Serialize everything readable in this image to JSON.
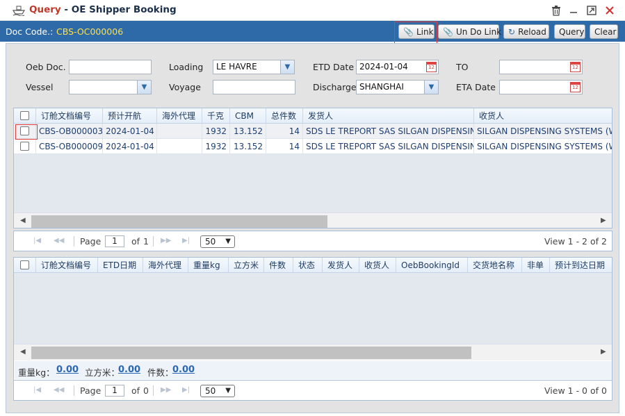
{
  "window": {
    "title_prefix": "Query",
    "title_separator": " - ",
    "title_main": "OE Shipper Booking",
    "icons": [
      "ship-icon",
      "trash-icon",
      "minimize-icon",
      "maximize-icon",
      "close-icon"
    ]
  },
  "docbar": {
    "label": "Doc Code.:",
    "value": "CBS-OC000006",
    "buttons": {
      "link": "Link",
      "undo_link": "Un Do Link",
      "reload": "Reload",
      "query": "Query",
      "clear": "Clear"
    }
  },
  "filters": {
    "oeb_doc_label": "Oeb Doc.",
    "oeb_doc_value": "",
    "loading_label": "Loading",
    "loading_value": "LE HAVRE",
    "etd_label": "ETD Date",
    "etd_value": "2024-01-04",
    "to_label": "TO",
    "to_value": "",
    "vessel_label": "Vessel",
    "vessel_value": "",
    "voyage_label": "Voyage",
    "voyage_value": "",
    "discharge_label": "Discharge",
    "discharge_value": "SHANGHAI",
    "eta_label": "ETA Date",
    "eta_value": ""
  },
  "grid1": {
    "columns": [
      "订舱文档编号",
      "预计开航",
      "海外代理",
      "千克",
      "CBM",
      "总件数",
      "发货人",
      "收货人"
    ],
    "rows": [
      [
        "CBS-OB000003",
        "2024-01-04",
        "",
        "1932",
        "13.152",
        "14",
        "SDS LE TREPORT SAS SILGAN DISPENSING",
        "SILGAN DISPENSING SYSTEMS (WU"
      ],
      [
        "CBS-OB000009",
        "2024-01-04",
        "",
        "1932",
        "13.152",
        "14",
        "SDS LE TREPORT SAS SILGAN DISPENSING",
        "SILGAN DISPENSING SYSTEMS (WU"
      ]
    ]
  },
  "pager1": {
    "page_label": "Page",
    "page_value": "1",
    "of_label": "of",
    "of_value": "1",
    "page_size": "50",
    "view_text": "View 1 - 2 of 2"
  },
  "grid2": {
    "columns": [
      "订舱文档编号",
      "ETD日期",
      "海外代理",
      "重量kg",
      "立方米",
      "件数",
      "状态",
      "发货人",
      "收货人",
      "OebBookingId",
      "交货地名称",
      "非单",
      "预计到达日期"
    ]
  },
  "totals": {
    "weight_label": "重量kg：",
    "weight_value": "0.00",
    "cbm_label": "立方米：",
    "cbm_value": "0.00",
    "pieces_label": "件数：",
    "pieces_value": "0.00"
  },
  "pager2": {
    "page_label": "Page",
    "page_value": "1",
    "of_label": "of",
    "of_value": "0",
    "page_size": "50",
    "view_text": "View 1 - 0 of 0"
  }
}
